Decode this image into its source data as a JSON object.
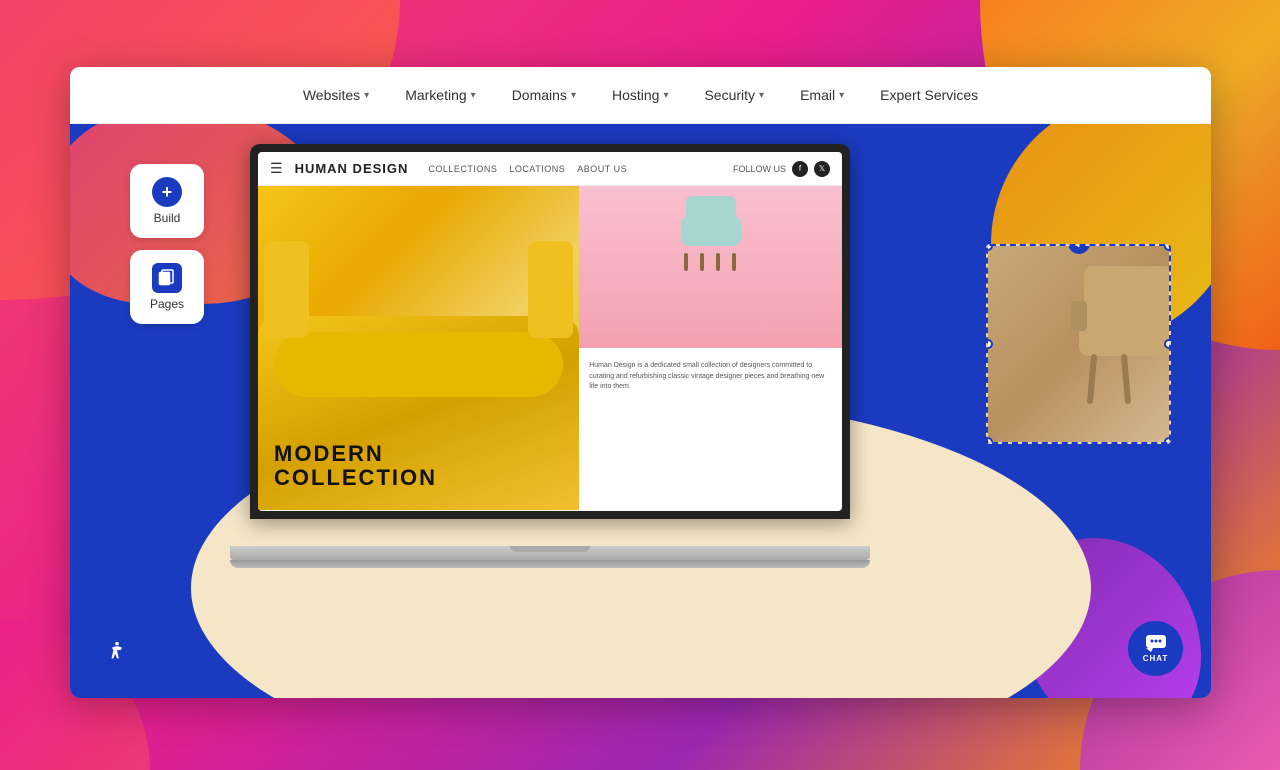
{
  "outer": {
    "bg_color": "#e91e8c"
  },
  "navbar": {
    "items": [
      {
        "label": "Websites",
        "has_chevron": true
      },
      {
        "label": "Marketing",
        "has_chevron": true
      },
      {
        "label": "Domains",
        "has_chevron": true
      },
      {
        "label": "Hosting",
        "has_chevron": true
      },
      {
        "label": "Security",
        "has_chevron": true
      },
      {
        "label": "Email",
        "has_chevron": true
      },
      {
        "label": "Expert Services",
        "has_chevron": false
      }
    ]
  },
  "sidebar": {
    "build_label": "Build",
    "pages_label": "Pages"
  },
  "mini_site": {
    "brand": "HUMAN DESIGN",
    "nav_collections": "COLLECTIONS",
    "nav_locations": "LOCATIONS",
    "nav_about": "ABOUT US",
    "follow_label": "FOLLOW US",
    "hero_title_line1": "MODERN",
    "hero_title_line2": "COLLECTION",
    "description": "Human Design is a dedicated small collection of designers committed to curating and refurbishing classic vintage designer pieces and breathing new life into them."
  },
  "chat": {
    "label": "CHAT"
  },
  "accessibility": {
    "label": "accessibility"
  },
  "plus_icon": "+",
  "drag_plus_icon": "+"
}
